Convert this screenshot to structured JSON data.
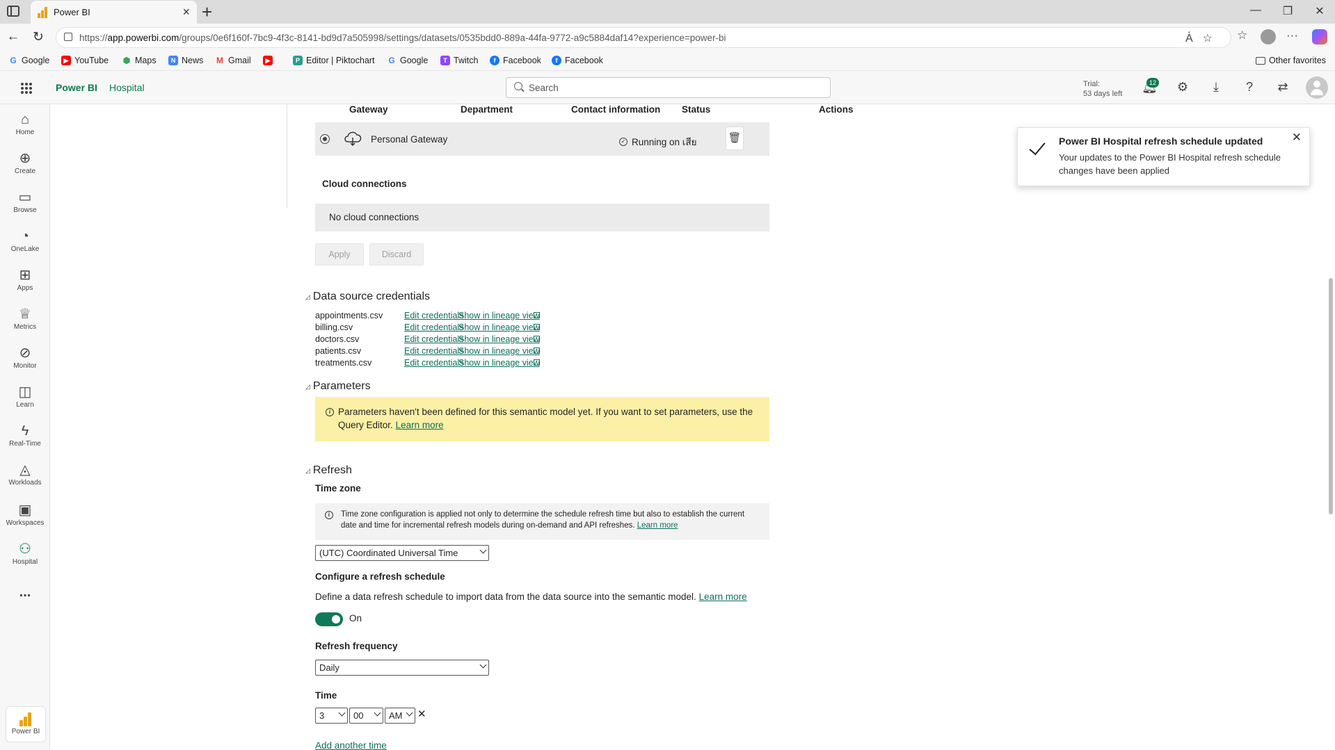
{
  "browser": {
    "tab_title": "Power BI",
    "url_prefix": "https://",
    "url_host": "app.powerbi.com",
    "url_path": "/groups/0e6f160f-7bc9-4f3c-8141-bd9d7a505998/settings/datasets/0535bdd0-889a-44fa-9772-a9c5884daf14?experience=power-bi",
    "favorites": [
      "Google",
      "YouTube",
      "Maps",
      "News",
      "Gmail",
      "",
      "Editor | Piktochart",
      "Google",
      "Twitch",
      "Facebook",
      "Facebook"
    ],
    "other_favorites": "Other favorites"
  },
  "header": {
    "app_name": "Power BI",
    "workspace": "Hospital",
    "search_placeholder": "Search",
    "trial_line1": "Trial:",
    "trial_line2": "53 days left",
    "notification_count": "12"
  },
  "leftnav": {
    "items": [
      "Home",
      "Create",
      "Browse",
      "OneLake",
      "Apps",
      "Metrics",
      "Monitor",
      "Learn",
      "Real-Time",
      "Workloads",
      "Workspaces",
      "Hospital"
    ],
    "more": "...",
    "powerbi": "Power BI"
  },
  "gateway": {
    "headers": [
      "Gateway",
      "Department",
      "Contact information",
      "Status",
      "Actions"
    ],
    "name": "Personal Gateway",
    "status": "Running on เสีย"
  },
  "cloud": {
    "title": "Cloud connections",
    "empty": "No cloud connections",
    "apply": "Apply",
    "discard": "Discard"
  },
  "credentials": {
    "title": "Data source credentials",
    "edit_label": "Edit credentials",
    "lineage_label": "Show in lineage view",
    "files": [
      "appointments.csv",
      "billing.csv",
      "doctors.csv",
      "patients.csv",
      "treatments.csv"
    ]
  },
  "parameters": {
    "title": "Parameters",
    "message": "Parameters haven't been defined for this semantic model yet. If you want to set parameters, use the Query Editor.",
    "link": "Learn more"
  },
  "refresh": {
    "title": "Refresh",
    "timezone_label": "Time zone",
    "timezone_info": "Time zone configuration is applied not only to determine the schedule refresh time but also to establish the current date and time for incremental refresh models during on-demand and API refreshes.",
    "timezone_link": "Learn more",
    "timezone_value": "(UTC) Coordinated Universal Time",
    "configure_label": "Configure a refresh schedule",
    "configure_desc": "Define a data refresh schedule to import data from the data source into the semantic model.",
    "configure_link": "Learn more",
    "toggle_label": "On",
    "frequency_label": "Refresh frequency",
    "frequency_value": "Daily",
    "time_label": "Time",
    "hour": "3",
    "minute": "00",
    "ampm": "AM",
    "clear": "✕",
    "add_time": "Add another time"
  },
  "toast": {
    "title": "Power BI Hospital refresh schedule updated",
    "body": "Your updates to the Power BI Hospital refresh schedule changes have been applied"
  }
}
